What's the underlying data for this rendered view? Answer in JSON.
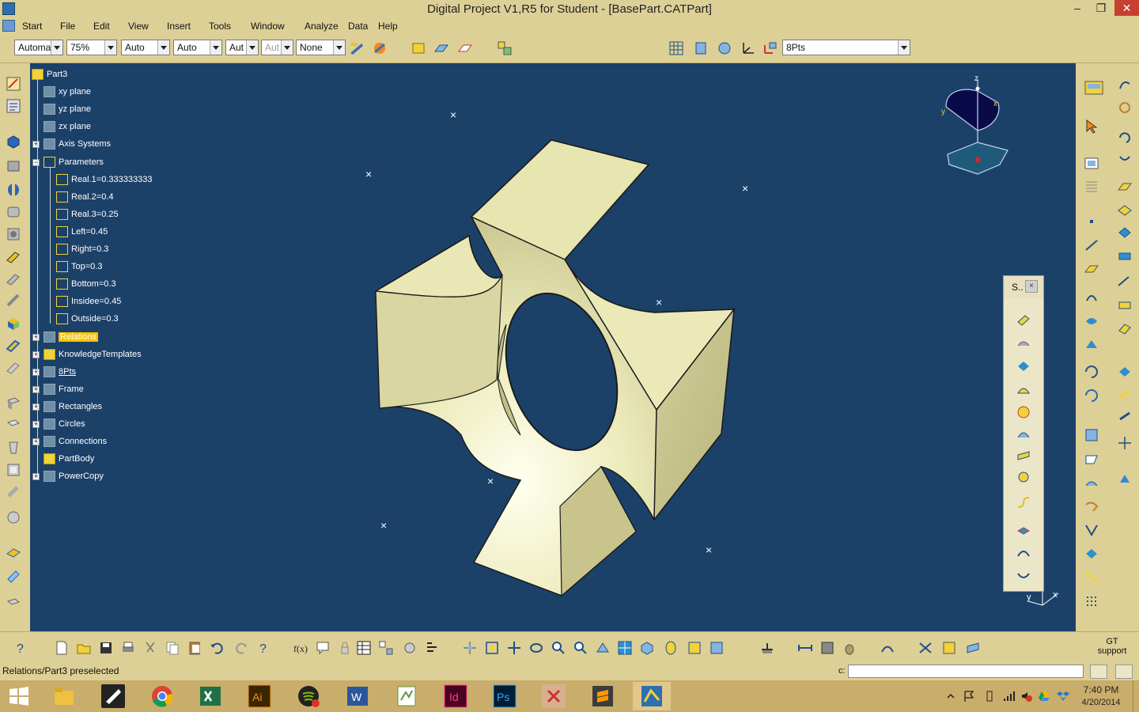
{
  "window": {
    "title": "Digital Project V1,R5 for Student - [BasePart.CATPart]",
    "controls": {
      "minimize": "–",
      "restore": "❐",
      "close": "✕"
    }
  },
  "menu": [
    "Start",
    "File",
    "Edit",
    "View",
    "Insert",
    "Tools",
    "Window",
    "Analyze",
    "Data",
    "Help"
  ],
  "toolbar": {
    "combos": [
      {
        "value": "Automa",
        "disabled": false
      },
      {
        "value": "75%",
        "disabled": false
      },
      {
        "value": "Auto",
        "disabled": false
      },
      {
        "value": "Auto",
        "disabled": false
      },
      {
        "value": "Aut",
        "disabled": false
      },
      {
        "value": "Aut",
        "disabled": true
      },
      {
        "value": "None",
        "disabled": false
      }
    ],
    "layer_select": "8Pts"
  },
  "tree": [
    {
      "label": "Part3",
      "icon": "part-icon",
      "level": 0,
      "expander": null
    },
    {
      "label": "xy plane",
      "icon": "plane-icon",
      "level": 1,
      "expander": null
    },
    {
      "label": "yz plane",
      "icon": "plane-icon",
      "level": 1,
      "expander": null
    },
    {
      "label": "zx plane",
      "icon": "plane-icon",
      "level": 1,
      "expander": null
    },
    {
      "label": "Axis Systems",
      "icon": "axis-icon",
      "level": 1,
      "expander": "+"
    },
    {
      "label": "Parameters",
      "icon": "parameters-icon",
      "level": 1,
      "expander": "-"
    },
    {
      "label": "Real.1=0.333333333",
      "icon": "parameter-icon",
      "level": 2,
      "expander": null
    },
    {
      "label": "Real.2=0.4",
      "icon": "parameter-icon",
      "level": 2,
      "expander": null
    },
    {
      "label": "Real.3=0.25",
      "icon": "parameter-icon",
      "level": 2,
      "expander": null
    },
    {
      "label": "Left=0.45",
      "icon": "parameter-icon",
      "level": 2,
      "expander": null
    },
    {
      "label": "Right=0.3",
      "icon": "parameter-icon",
      "level": 2,
      "expander": null
    },
    {
      "label": "Top=0.3",
      "icon": "parameter-icon",
      "level": 2,
      "expander": null
    },
    {
      "label": "Bottom=0.3",
      "icon": "parameter-icon",
      "level": 2,
      "expander": null
    },
    {
      "label": "Insidee=0.45",
      "icon": "parameter-icon",
      "level": 2,
      "expander": null
    },
    {
      "label": "Outside=0.3",
      "icon": "parameter-icon",
      "level": 2,
      "expander": null
    },
    {
      "label": "Relations",
      "icon": "relations-icon",
      "level": 1,
      "expander": "+",
      "selected": true
    },
    {
      "label": "KnowledgeTemplates",
      "icon": "folder-icon",
      "level": 1,
      "expander": "+"
    },
    {
      "label": "8Pts",
      "icon": "geoset-icon",
      "level": 1,
      "expander": "+",
      "underlined": true
    },
    {
      "label": "Frame",
      "icon": "geoset-icon",
      "level": 1,
      "expander": "+"
    },
    {
      "label": "Rectangles",
      "icon": "geoset-icon",
      "level": 1,
      "expander": "+"
    },
    {
      "label": "Circles",
      "icon": "geoset-icon",
      "level": 1,
      "expander": "+"
    },
    {
      "label": "Connections",
      "icon": "geoset-icon",
      "level": 1,
      "expander": "+"
    },
    {
      "label": "PartBody",
      "icon": "partbody-icon",
      "level": 1,
      "expander": null
    },
    {
      "label": "PowerCopy",
      "icon": "powercopy-icon",
      "level": 1,
      "expander": "+"
    }
  ],
  "compass": {
    "z": "z",
    "x": "x",
    "y": "y"
  },
  "floating_toolbar": {
    "title": "S..",
    "close": "×"
  },
  "axis_indicator": {
    "x": "x",
    "y": "y"
  },
  "bottom": {
    "gt_support": "GT support"
  },
  "status": {
    "text": "Relations/Part3 preselected",
    "cmd_label": "c:",
    "cmd_value": ""
  },
  "taskbar": {
    "apps": [
      "start-icon",
      "file-explorer-icon",
      "inkscape-icon",
      "chrome-icon",
      "excel-icon",
      "illustrator-icon",
      "spotify-icon",
      "word-icon",
      "notepad-icon",
      "indesign-icon",
      "photoshop-icon",
      "snipping-tool-icon",
      "sublime-icon",
      "digital-project-icon"
    ],
    "time": "7:40 PM",
    "date": "4/20/2014"
  },
  "colors": {
    "chrome": "#ddd096",
    "viewport": "#1c4169",
    "part_fill": "#e8e6b4",
    "selection": "#f6c400"
  }
}
